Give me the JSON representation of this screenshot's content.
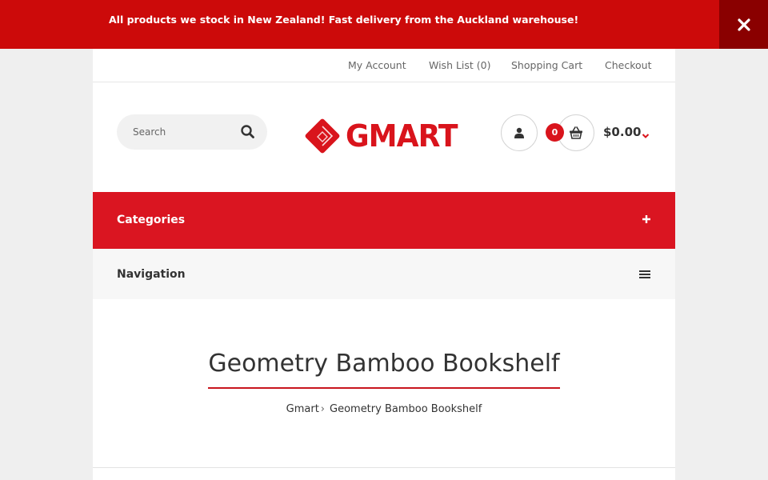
{
  "promo": {
    "text": "All products we stock in New Zealand! Fast delivery from the Auckland warehouse!"
  },
  "toplinks": {
    "my_account": "My Account",
    "wish_list": "Wish List (0)",
    "shopping_cart": "Shopping Cart",
    "checkout": "Checkout"
  },
  "search": {
    "placeholder": "Search"
  },
  "logo": {
    "text": "GMART"
  },
  "cart": {
    "count": "0",
    "total": "$0.00"
  },
  "categories": {
    "label": "Categories"
  },
  "navigation": {
    "label": "Navigation"
  },
  "page": {
    "title": "Geometry Bamboo Bookshelf"
  },
  "breadcrumb": {
    "home": "Gmart",
    "separator": "›",
    "current": "Geometry Bamboo Bookshelf"
  },
  "colors": {
    "brand_red": "#da1521",
    "promo_red": "#cc0a0a",
    "close_bg": "#8a0000"
  },
  "icons": {
    "close": "close-icon",
    "search": "search-icon",
    "user": "user-icon",
    "cart": "basket-icon",
    "chevron": "chevron-down-icon",
    "plus": "plus-icon",
    "menu": "menu-icon"
  }
}
